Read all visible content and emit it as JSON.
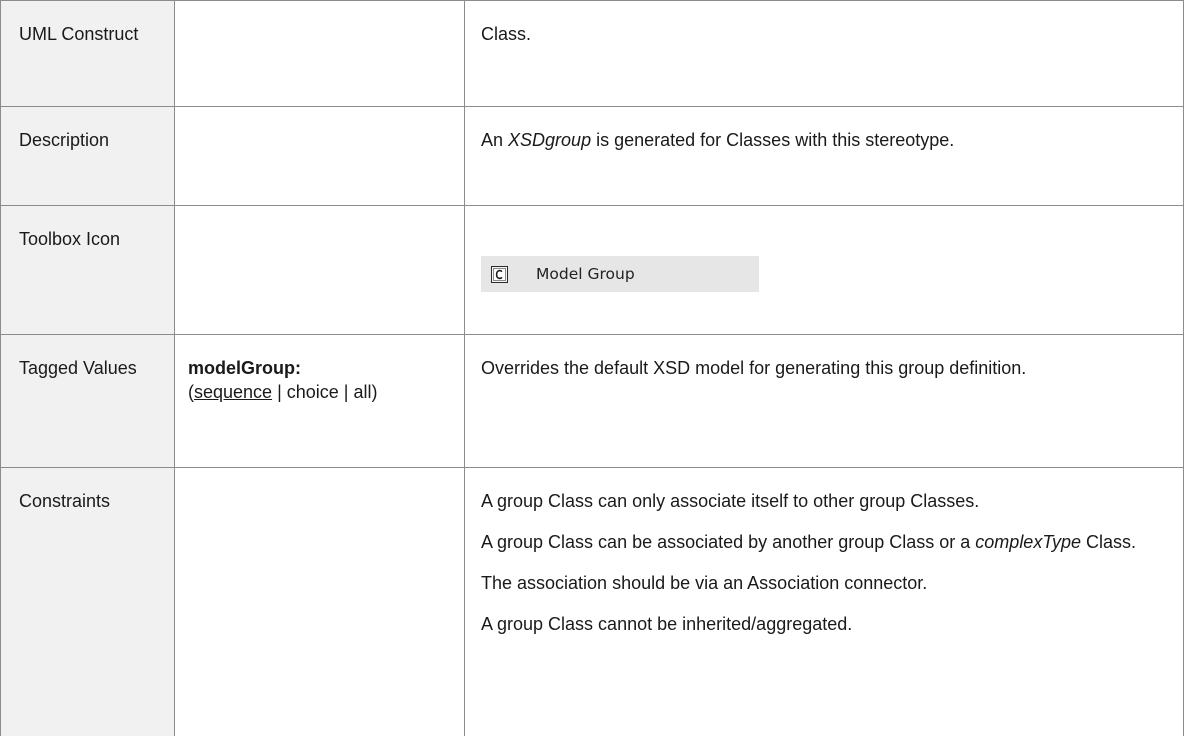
{
  "rows": {
    "uml": {
      "label": "UML Construct",
      "value": "Class."
    },
    "description": {
      "label": "Description",
      "pre": "An ",
      "em": "XSDgroup",
      "post": " is generated for Classes with this stereotype."
    },
    "toolbox": {
      "label": "Toolbox Icon",
      "icon": "class-c-icon",
      "item_label": "Model Group"
    },
    "tagged": {
      "label": "Tagged Values",
      "name": "modelGroup:",
      "opt_open": "(",
      "opt_default": "sequence",
      "opt_rest": " | choice | all)",
      "value": "Overrides the default XSD model for generating this group definition."
    },
    "constraints": {
      "label": "Constraints",
      "c1": "A group Class can only associate itself to other group Classes.",
      "c2_pre": "A group Class can be associated by another group Class or a ",
      "c2_em": "complexType",
      "c2_post": " Class.",
      "c3": "The association should be via an Association connector.",
      "c4": "A group Class cannot be inherited/aggregated."
    }
  },
  "colors": {
    "border": "#8c8c8c",
    "label_bg": "#f1f1f1",
    "toolbox_bg": "#e6e6e6"
  }
}
